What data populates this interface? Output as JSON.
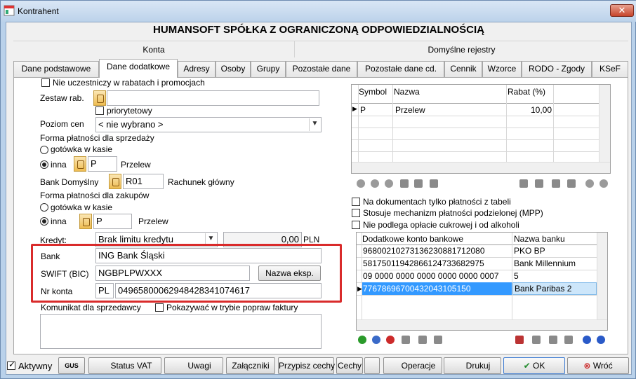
{
  "window": {
    "title": "Kontrahent",
    "close_label": "✕"
  },
  "company_name": "HUMANSOFT SPÓŁKA Z OGRANICZONĄ ODPOWIEDZIALNOŚCIĄ",
  "group_headers": {
    "konta": "Konta",
    "rejestry": "Domyślne rejestry"
  },
  "tabs": [
    "Dane podstawowe",
    "Dane dodatkowe",
    "Adresy",
    "Osoby",
    "Grupy",
    "Pozostałe dane",
    "Pozostałe dane cd.",
    "Cennik",
    "Wzorce",
    "RODO - Zgody",
    "KSeF"
  ],
  "active_tab": "Dane dodatkowe",
  "left": {
    "nie_uczestniczy": "Nie uczestniczy w rabatach i promocjach",
    "zestaw_rab_label": "Zestaw rab.",
    "zestaw_rab_value": "",
    "priorytetowy": "priorytetowy",
    "poziom_cen_label": "Poziom cen",
    "poziom_cen_value": "< nie wybrano >",
    "forma_sprz_label": "Forma płatności dla sprzedaży",
    "gotowka_sprz": "gotówka w kasie",
    "inna_sprz": "inna",
    "forma_sprz_code": "P",
    "forma_sprz_name": "Przelew",
    "bank_domyslny_label": "Bank Domyślny",
    "bank_domyslny_code": "R01",
    "bank_domyslny_name": "Rachunek główny",
    "forma_zak_label": "Forma płatności dla zakupów",
    "gotowka_zak": "gotówka w kasie",
    "inna_zak": "inna",
    "forma_zak_code": "P",
    "forma_zak_name": "Przelew",
    "kredyt_label": "Kredyt:",
    "kredyt_value": "Brak limitu kredytu",
    "kredyt_amount": "0,00",
    "kredyt_currency": "PLN",
    "bank_label": "Bank",
    "bank_value": "ING Bank Śląski",
    "swift_label": "SWIFT (BIC)",
    "swift_value": "NGBPLPWXXX",
    "nazwa_eksp_button": "Nazwa eksp.",
    "nr_konta_label": "Nr konta",
    "nr_konta_country": "PL",
    "nr_konta_value": "04965800062948428341074617",
    "komunikat_label": "Komunikat dla sprzedawcy",
    "pokazywac": "Pokazywać w trybie popraw faktury",
    "komunikat_value": ""
  },
  "rabaty_grid": {
    "headers": {
      "symbol": "Symbol",
      "nazwa": "Nazwa",
      "rabat": "Rabat (%)"
    },
    "rows": [
      {
        "symbol": "P",
        "nazwa": "Przelew",
        "rabat": "10,00"
      }
    ]
  },
  "right_checks": {
    "tylko_tabeli": "Na dokumentach tylko płatności z tabeli",
    "mpp": "Stosuje mechanizm płatności podzielonej (MPP)",
    "cukrowej": "Nie podlega opłacie cukrowej i od alkoholi"
  },
  "konta_grid": {
    "headers": {
      "konto": "Dodatkowe konto bankowe",
      "bank": "Nazwa banku"
    },
    "rows": [
      {
        "konto": "96800210273136230881712080",
        "bank": "PKO BP"
      },
      {
        "konto": "58175011942866124733682975",
        "bank": "Bank Millennium"
      },
      {
        "konto": "09 0000 0000 0000 0000 0000 0007",
        "bank": "5"
      },
      {
        "konto": "77678696700432043105150",
        "bank": "Bank Paribas 2"
      }
    ]
  },
  "bottom": {
    "aktywny": "Aktywny",
    "gus": "GUS",
    "status_vat": "Status VAT",
    "uwagi": "Uwagi",
    "zalaczniki": "Załączniki",
    "przypisz_cechy": "Przypisz cechy",
    "cechy": "Cechy",
    "operacje": "Operacje",
    "drukuj": "Drukuj",
    "ok": "OK",
    "wroc": "Wróć"
  }
}
